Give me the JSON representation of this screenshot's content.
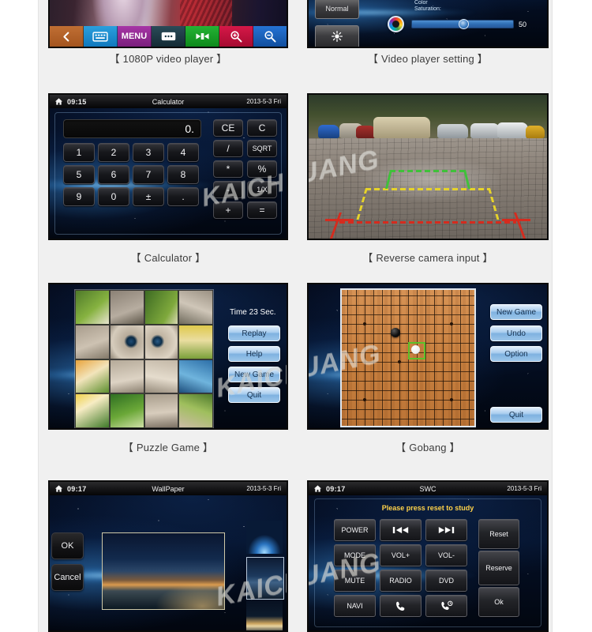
{
  "panels": [
    {
      "id": "video-player",
      "caption": "【 1080P video player 】",
      "toolbar": [
        {
          "label": "",
          "icon": "back-icon",
          "color": "#b5622c"
        },
        {
          "label": "",
          "icon": "keyboard-icon",
          "color": "#1d8fcf"
        },
        {
          "label": "MENU",
          "icon": "menu-label",
          "color": "#8e2a8e"
        },
        {
          "label": "",
          "icon": "more-icon",
          "color": "#1d3b47"
        },
        {
          "label": "",
          "icon": "video-icon",
          "color": "#179b26"
        },
        {
          "label": "",
          "icon": "zoom-in-icon",
          "color": "#c00f3c"
        },
        {
          "label": "",
          "icon": "zoom-out-icon",
          "color": "#1660bd"
        }
      ]
    },
    {
      "id": "video-setting",
      "caption": "【 Video player setting 】",
      "mode_button": "Normal",
      "brightness_button_icon": "brightness-icon",
      "slider_label_line1": "Color",
      "slider_label_line2": "Saturation:",
      "slider_value": "50",
      "slider_percent": 50
    },
    {
      "id": "calculator",
      "caption": "【 Calculator 】",
      "statusbar": {
        "time": "09:15",
        "title": "Calculator",
        "date": "2013-5-3 Fri",
        "home_icon": "home-icon"
      },
      "display": "0.",
      "keys_numeric": [
        [
          "1",
          "2",
          "3",
          "4"
        ],
        [
          "5",
          "6",
          "7",
          "8"
        ],
        [
          "9",
          "0",
          "±",
          "."
        ]
      ],
      "keys_function": [
        [
          "CE",
          "C"
        ],
        [
          "/",
          "SQRT"
        ],
        [
          "*",
          "%"
        ],
        [
          "-",
          "1/X"
        ],
        [
          "+",
          "="
        ]
      ],
      "watermark": "KAICH"
    },
    {
      "id": "reverse-camera",
      "caption": "【 Reverse camera input 】",
      "watermark": "UANG",
      "guide_colors": {
        "near": "#d52b1e",
        "mid": "#e6d32a",
        "far": "#3fc13a"
      }
    },
    {
      "id": "puzzle-game",
      "caption": "【 Puzzle Game 】",
      "timer_text": "Time 23 Sec.",
      "buttons": [
        "Replay",
        "Help",
        "New Game",
        "Quit"
      ],
      "watermark": "KAICH",
      "grid_size": "4x4"
    },
    {
      "id": "gobang",
      "caption": "【 Gobang 】",
      "buttons": [
        "New Game",
        "Undo",
        "Option",
        "Quit"
      ],
      "watermark": "UANG"
    },
    {
      "id": "wallpaper",
      "caption": "",
      "statusbar": {
        "time": "09:17",
        "title": "WallPaper",
        "date": "2013-5-3 Fri",
        "home_icon": "home-icon"
      },
      "buttons": [
        "OK",
        "Cancel"
      ],
      "watermark": "KAICH",
      "thumbnail_count": 3
    },
    {
      "id": "swc",
      "caption": "",
      "statusbar": {
        "time": "09:17",
        "title": "SWC",
        "date": "2013-5-3 Fri",
        "home_icon": "home-icon"
      },
      "hint": "Please press reset to study",
      "keys": [
        {
          "label": "POWER",
          "icon": ""
        },
        {
          "label": "",
          "icon": "prev-track-icon"
        },
        {
          "label": "",
          "icon": "next-track-icon"
        },
        {
          "label": "MODE",
          "icon": ""
        },
        {
          "label": "VOL+",
          "icon": ""
        },
        {
          "label": "VOL-",
          "icon": ""
        },
        {
          "label": "MUTE",
          "icon": ""
        },
        {
          "label": "RADIO",
          "icon": ""
        },
        {
          "label": "DVD",
          "icon": ""
        },
        {
          "label": "NAVI",
          "icon": ""
        },
        {
          "label": "",
          "icon": "phone-icon"
        },
        {
          "label": "",
          "icon": "phone-end-icon"
        }
      ],
      "side_buttons": [
        "Reset",
        "Reserve",
        "Ok"
      ],
      "watermark": "UANG"
    }
  ]
}
